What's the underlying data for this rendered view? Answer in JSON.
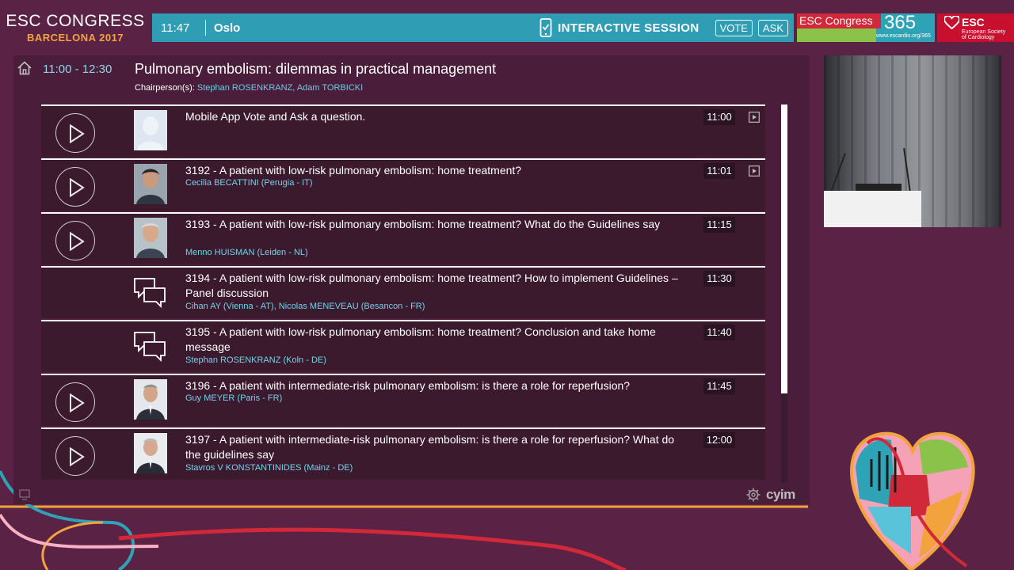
{
  "brand": {
    "title": "ESC CONGRESS",
    "subtitle": "BARCELONA 2017"
  },
  "infobar": {
    "time": "11:47",
    "room": "Oslo",
    "session_label": "INTERACTIVE SESSION",
    "vote_label": "VOTE",
    "ask_label": "ASK"
  },
  "logos": {
    "congress365_text": "ESC Congress",
    "congress365_number": "365",
    "congress365_url": "www.escardio.org/365",
    "esc_name": "ESC",
    "esc_sub_line1": "European Society",
    "esc_sub_line2": "of Cardiology"
  },
  "session": {
    "time_range": "11:00 - 12:30",
    "title": "Pulmonary embolism: dilemmas in practical management",
    "chair_label": "Chairperson(s):",
    "chair_names": "Stephan ROSENKRANZ, Adam TORBICKI"
  },
  "talks": [
    {
      "title": "Mobile App Vote and Ask a question.",
      "speaker": "",
      "time": "11:00"
    },
    {
      "title": "3192 - A patient with low-risk pulmonary embolism: home treatment?",
      "speaker": "Cecilia BECATTINI (Perugia - IT)",
      "time": "11:01"
    },
    {
      "title": "3193 - A patient with low-risk pulmonary embolism: home treatment? What do the Guidelines say",
      "speaker": "Menno HUISMAN (Leiden - NL)",
      "time": "11:15"
    },
    {
      "title": "3194 - A patient with low-risk pulmonary embolism: home treatment? How to implement Guidelines – Panel discussion",
      "speaker": "Cihan AY (Vienna - AT), Nicolas MENEVEAU (Besancon - FR)",
      "time": "11:30"
    },
    {
      "title": "3195 - A patient with low-risk pulmonary embolism: home treatment? Conclusion and take home message",
      "speaker": "Stephan ROSENKRANZ (Koln - DE)",
      "time": "11:40"
    },
    {
      "title": "3196 - A patient with intermediate-risk pulmonary embolism: is there a role for reperfusion?",
      "speaker": "Guy MEYER (Paris - FR)",
      "time": "11:45"
    },
    {
      "title": "3197 - A patient with intermediate-risk pulmonary embolism: is there a role for reperfusion? What do the guidelines say",
      "speaker": "Stavros V KONSTANTINIDES (Mainz - DE)",
      "time": "12:00"
    }
  ],
  "footer": {
    "provider": "cyim"
  },
  "colors": {
    "background": "#5a2346",
    "infobar": "#2f9db4",
    "accent_blue": "#6fd4ea",
    "brand_orange": "#f3a33b",
    "esc_red": "#c8102e"
  }
}
